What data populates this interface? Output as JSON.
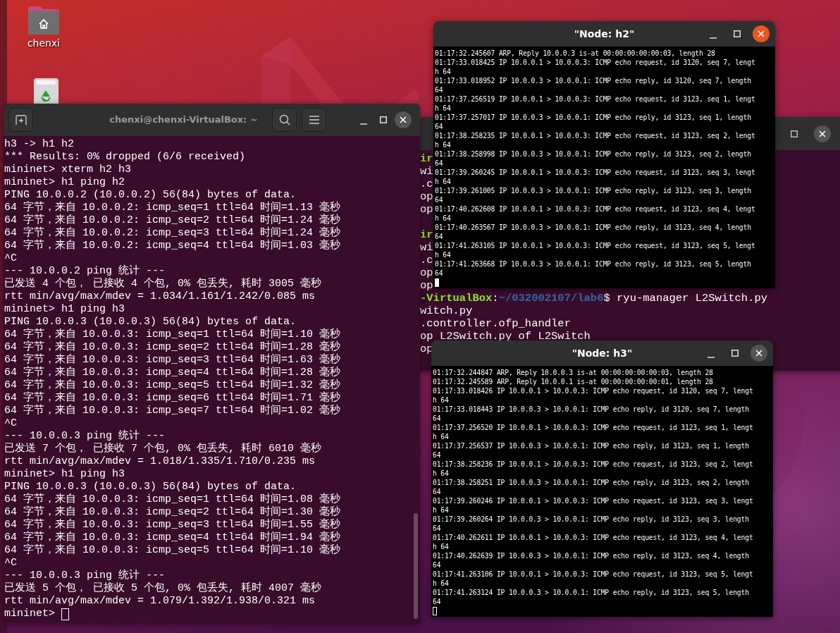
{
  "desktop": {
    "icons": [
      {
        "kind": "home",
        "label": "chenxi"
      },
      {
        "kind": "trash"
      }
    ]
  },
  "background_terminal": {
    "lines": [
      {
        "kind": "prompt",
        "user": "ir"
      },
      {
        "kind": "text",
        "text": "wi"
      },
      {
        "kind": "text",
        "text": ".c"
      },
      {
        "kind": "text",
        "text": "op"
      },
      {
        "kind": "text",
        "text": "op"
      },
      {
        "kind": "blank"
      },
      {
        "kind": "prompt",
        "user": "ir"
      },
      {
        "kind": "text",
        "text": "wi"
      },
      {
        "kind": "text",
        "text": ".c"
      },
      {
        "kind": "text",
        "text": "op"
      },
      {
        "kind": "text",
        "text": "op"
      },
      {
        "kind": "prompt",
        "user": "-VirtualBox",
        "sep": ":",
        "path": "~/032002107/lab6",
        "cmd": "$ ryu-manager L2Switch.py"
      },
      {
        "kind": "text",
        "text": "witch.py"
      },
      {
        "kind": "text",
        "text": ".controller.ofp_handler"
      },
      {
        "kind": "text",
        "text": "op L2Switch.py of L2Switch"
      },
      {
        "kind": "text",
        "text": "op"
      }
    ]
  },
  "main_terminal": {
    "title": "chenxi@chenxi-VirtualBox: ~",
    "active": false,
    "lines": [
      "h3 -> h1 h2",
      "*** Results: 0% dropped (6/6 received)",
      "mininet> xterm h2 h3",
      "mininet> h1 ping h2",
      "PING 10.0.0.2 (10.0.0.2) 56(84) bytes of data.",
      "64 字节，来自 10.0.0.2: icmp_seq=1 ttl=64 时间=1.13 毫秒",
      "64 字节，来自 10.0.0.2: icmp_seq=2 ttl=64 时间=1.24 毫秒",
      "64 字节，来自 10.0.0.2: icmp_seq=3 ttl=64 时间=1.24 毫秒",
      "64 字节，来自 10.0.0.2: icmp_seq=4 ttl=64 时间=1.03 毫秒",
      "^C",
      "--- 10.0.0.2 ping 统计 ---",
      "已发送 4 个包， 已接收 4 个包, 0% 包丢失, 耗时 3005 毫秒",
      "rtt min/avg/max/mdev = 1.034/1.161/1.242/0.085 ms",
      "mininet> h1 ping h3",
      "PING 10.0.0.3 (10.0.0.3) 56(84) bytes of data.",
      "64 字节，来自 10.0.0.3: icmp_seq=1 ttl=64 时间=1.10 毫秒",
      "64 字节，来自 10.0.0.3: icmp_seq=2 ttl=64 时间=1.28 毫秒",
      "64 字节，来自 10.0.0.3: icmp_seq=3 ttl=64 时间=1.63 毫秒",
      "64 字节，来自 10.0.0.3: icmp_seq=4 ttl=64 时间=1.28 毫秒",
      "64 字节，来自 10.0.0.3: icmp_seq=5 ttl=64 时间=1.32 毫秒",
      "64 字节，来自 10.0.0.3: icmp_seq=6 ttl=64 时间=1.71 毫秒",
      "64 字节，来自 10.0.0.3: icmp_seq=7 ttl=64 时间=1.02 毫秒",
      "^C",
      "--- 10.0.0.3 ping 统计 ---",
      "已发送 7 个包， 已接收 7 个包, 0% 包丢失, 耗时 6010 毫秒",
      "rtt min/avg/max/mdev = 1.018/1.335/1.710/0.235 ms",
      "mininet> h1 ping h3",
      "PING 10.0.0.3 (10.0.0.3) 56(84) bytes of data.",
      "64 字节，来自 10.0.0.3: icmp_seq=1 ttl=64 时间=1.08 毫秒",
      "64 字节，来自 10.0.0.3: icmp_seq=2 ttl=64 时间=1.30 毫秒",
      "64 字节，来自 10.0.0.3: icmp_seq=3 ttl=64 时间=1.55 毫秒",
      "64 字节，来自 10.0.0.3: icmp_seq=4 ttl=64 时间=1.94 毫秒",
      "64 字节，来自 10.0.0.3: icmp_seq=5 ttl=64 时间=1.10 毫秒",
      "^C",
      "--- 10.0.0.3 ping 统计 ---",
      "已发送 5 个包， 已接收 5 个包, 0% 包丢失, 耗时 4007 毫秒",
      "rtt min/avg/max/mdev = 1.079/1.392/1.938/0.321 ms"
    ],
    "prompt": "mininet>"
  },
  "xterm_h2": {
    "title": "\"Node: h2\"",
    "active": true,
    "lines": [
      "01:17:32.245607 ARP, Reply 10.0.0.3 is-at 00:00:00:00:00:03, length 28",
      "01:17:33.018425 IP 10.0.0.1 > 10.0.0.3: ICMP echo request, id 3120, seq 7, lengt",
      "h 64",
      "01:17:33.018952 IP 10.0.0.3 > 10.0.0.1: ICMP echo reply, id 3120, seq 7, length",
      "64",
      "01:17:37.256519 IP 10.0.0.1 > 10.0.0.3: ICMP echo request, id 3123, seq 1, lengt",
      "h 64",
      "01:17:37.257017 IP 10.0.0.3 > 10.0.0.1: ICMP echo reply, id 3123, seq 1, length",
      "64",
      "01:17:38.258235 IP 10.0.0.1 > 10.0.0.3: ICMP echo request, id 3123, seq 2, lengt",
      "h 64",
      "01:17:38.258998 IP 10.0.0.3 > 10.0.0.1: ICMP echo reply, id 3123, seq 2, length",
      "64",
      "01:17:39.260245 IP 10.0.0.1 > 10.0.0.3: ICMP echo request, id 3123, seq 3, lengt",
      "h 64",
      "01:17:39.261005 IP 10.0.0.3 > 10.0.0.1: ICMP echo reply, id 3123, seq 3, length",
      "64",
      "01:17:40.262608 IP 10.0.0.1 > 10.0.0.3: ICMP echo request, id 3123, seq 4, lengt",
      "h 64",
      "01:17:40.263567 IP 10.0.0.3 > 10.0.0.1: ICMP echo reply, id 3123, seq 4, length",
      "64",
      "01:17:41.263105 IP 10.0.0.1 > 10.0.0.3: ICMP echo request, id 3123, seq 5, lengt",
      "h 64",
      "01:17:41.263668 IP 10.0.0.3 > 10.0.0.1: ICMP echo reply, id 3123, seq 5, length",
      "64"
    ]
  },
  "xterm_h3": {
    "title": "\"Node: h3\"",
    "active": false,
    "lines": [
      "01:17:32.244847 ARP, Reply 10.0.0.3 is-at 00:00:00:00:00:03, length 28",
      "01:17:32.245589 ARP, Reply 10.0.0.1 is-at 00:00:00:00:00:01, length 28",
      "01:17:33.018426 IP 10.0.0.1 > 10.0.0.3: ICMP echo request, id 3120, seq 7, lengt",
      "h 64",
      "01:17:33.018443 IP 10.0.0.3 > 10.0.0.1: ICMP echo reply, id 3120, seq 7, length",
      "64",
      "01:17:37.256520 IP 10.0.0.1 > 10.0.0.3: ICMP echo request, id 3123, seq 1, lengt",
      "h 64",
      "01:17:37.256537 IP 10.0.0.3 > 10.0.0.1: ICMP echo reply, id 3123, seq 1, length",
      "64",
      "01:17:38.258236 IP 10.0.0.1 > 10.0.0.3: ICMP echo request, id 3123, seq 2, lengt",
      "h 64",
      "01:17:38.258251 IP 10.0.0.3 > 10.0.0.1: ICMP echo reply, id 3123, seq 2, length",
      "64",
      "01:17:39.260246 IP 10.0.0.1 > 10.0.0.3: ICMP echo request, id 3123, seq 3, lengt",
      "h 64",
      "01:17:39.260264 IP 10.0.0.3 > 10.0.0.1: ICMP echo reply, id 3123, seq 3, length",
      "64",
      "01:17:40.262611 IP 10.0.0.1 > 10.0.0.3: ICMP echo request, id 3123, seq 4, lengt",
      "h 64",
      "01:17:40.262639 IP 10.0.0.3 > 10.0.0.1: ICMP echo reply, id 3123, seq 4, length",
      "64",
      "01:17:41.263106 IP 10.0.0.1 > 10.0.0.3: ICMP echo request, id 3123, seq 5, lengt",
      "h 64",
      "01:17:41.263124 IP 10.0.0.3 > 10.0.0.1: ICMP echo reply, id 3123, seq 5, length",
      "64"
    ]
  }
}
